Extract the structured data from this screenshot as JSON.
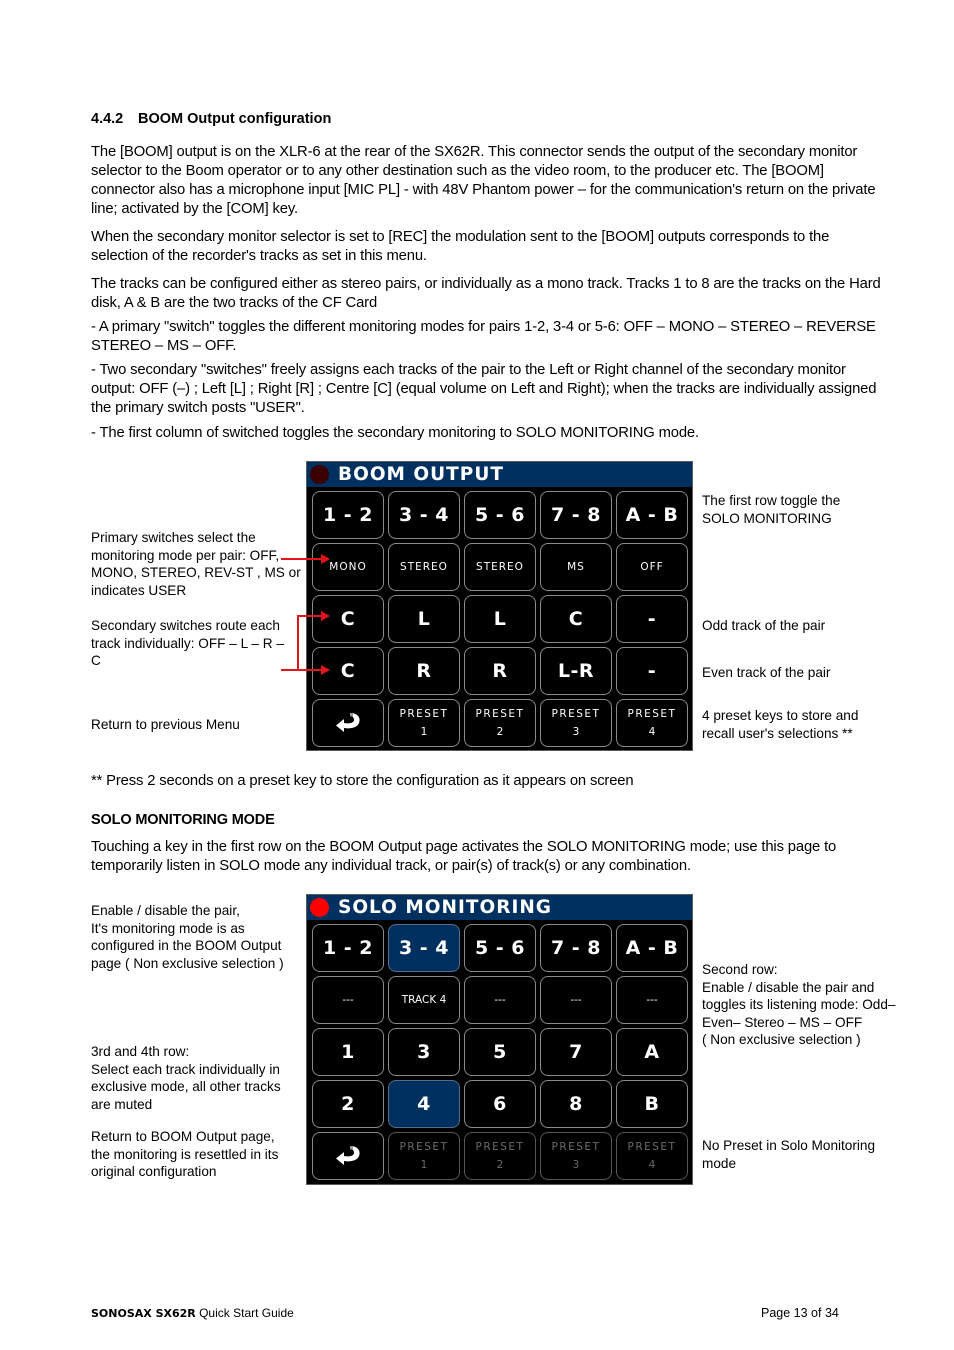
{
  "section": {
    "number": "4.4.2",
    "title": "BOOM Output configuration"
  },
  "paragraphs": {
    "p1": "The [BOOM] output is on the XLR-6 at the rear of the SX62R. This connector sends the output of the secondary monitor selector to the Boom operator or to any other destination such as the video room, to the producer etc. The [BOOM] connector also has a microphone input [MIC PL] - with 48V Phantom power – for the communication's return on the private line; activated by the [COM] key.",
    "p2": "When the secondary monitor selector is set to [REC] the modulation sent to the [BOOM] outputs corresponds to the selection of the recorder's tracks as set in this menu.",
    "p3": "The tracks can be configured either as stereo pairs, or individually as a mono track. Tracks 1 to 8 are the tracks on the Hard disk, A & B are the two tracks of the CF Card",
    "p4": "- A primary \"switch\" toggles the different monitoring modes for pairs 1-2, 3-4 or 5-6: OFF – MONO – STEREO – REVERSE STEREO – MS – OFF.",
    "p5": "- Two secondary \"switches\" freely assigns each tracks of the pair to the Left or Right channel of the secondary monitor output: OFF (–) ; Left [L] ; Right  [R] ; Centre [C] (equal volume on Left and Right); when the tracks are individually assigned the primary switch posts \"USER\".",
    "p6": "- The first column of switched toggles the secondary monitoring to SOLO MONITORING mode."
  },
  "boom_screen": {
    "title": "BOOM OUTPUT",
    "led_color": "#3a0000",
    "header_color": "#003060",
    "row1": [
      "1 - 2",
      "3 - 4",
      "5 - 6",
      "7 - 8",
      "A - B"
    ],
    "row2": [
      "MONO",
      "STEREO",
      "STEREO",
      "MS",
      "OFF"
    ],
    "row3": [
      "C",
      "L",
      "L",
      "C",
      "-"
    ],
    "row4": [
      "C",
      "R",
      "R",
      "L-R",
      "-"
    ],
    "presets": [
      {
        "label": "PRESET",
        "num": "1"
      },
      {
        "label": "PRESET",
        "num": "2"
      },
      {
        "label": "PRESET",
        "num": "3"
      },
      {
        "label": "PRESET",
        "num": "4"
      }
    ],
    "return_icon": "return-arrow-icon"
  },
  "boom_notes": {
    "primary": "Primary switches select the monitoring mode per pair: OFF, MONO, STEREO, REV-ST , MS or indicates USER",
    "secondary": "Secondary switches route each track individually: OFF – L – R – C",
    "return": "Return to previous Menu",
    "first_row": "The first row toggle the SOLO MONITORING",
    "odd": "Odd track of the pair",
    "even": "Even track of the pair",
    "presets": "4 preset keys to store and recall user's selections **"
  },
  "footnote": "** Press 2 seconds on a preset key to store the configuration as it appears on screen",
  "solo_section": {
    "title": "SOLO MONITORING MODE",
    "paragraph": "Touching a key in the first row on the BOOM Output page activates the SOLO MONITORING mode; use this page to temporarily listen in SOLO mode any individual track, or pair(s) of track(s) or any combination."
  },
  "solo_screen": {
    "title": "SOLO MONITORING",
    "led_color": "#ff0000",
    "header_color": "#003060",
    "row1": [
      "1 - 2",
      "3 - 4",
      "5 - 6",
      "7 - 8",
      "A - B"
    ],
    "row1_active_index": 1,
    "row2": [
      "---",
      "TRACK 4",
      "---",
      "---",
      "---"
    ],
    "row3": [
      "1",
      "3",
      "5",
      "7",
      "A"
    ],
    "row4": [
      "2",
      "4",
      "6",
      "8",
      "B"
    ],
    "row4_active_index": 1,
    "presets": [
      {
        "label": "PRESET",
        "num": "1"
      },
      {
        "label": "PRESET",
        "num": "2"
      },
      {
        "label": "PRESET",
        "num": "3"
      },
      {
        "label": "PRESET",
        "num": "4"
      }
    ],
    "presets_disabled": true,
    "return_icon": "return-arrow-icon"
  },
  "solo_notes": {
    "enable_pair": "Enable / disable the pair,\nIt's monitoring mode is as configured in the BOOM Output page ( Non exclusive selection )",
    "rows_3_4_title": "3rd and 4th row:",
    "rows_3_4": "Select each track individually in exclusive mode, all other tracks are muted",
    "return": "Return to BOOM Output page, the monitoring is resettled in its original configuration",
    "second_row_title": "Second row:",
    "second_row": "Enable / disable the pair  and toggles its listening mode: Odd– Even– Stereo – MS – OFF",
    "second_row_note": "( Non exclusive selection )",
    "no_preset": "No Preset in Solo Monitoring mode"
  },
  "footer": {
    "brand": "SONOSAX  SX62R",
    "doc": " Quick Start Guide",
    "page": "Page 13 of 34"
  },
  "colors": {
    "accent_red": "#e4141b",
    "active_key": "#003060"
  }
}
